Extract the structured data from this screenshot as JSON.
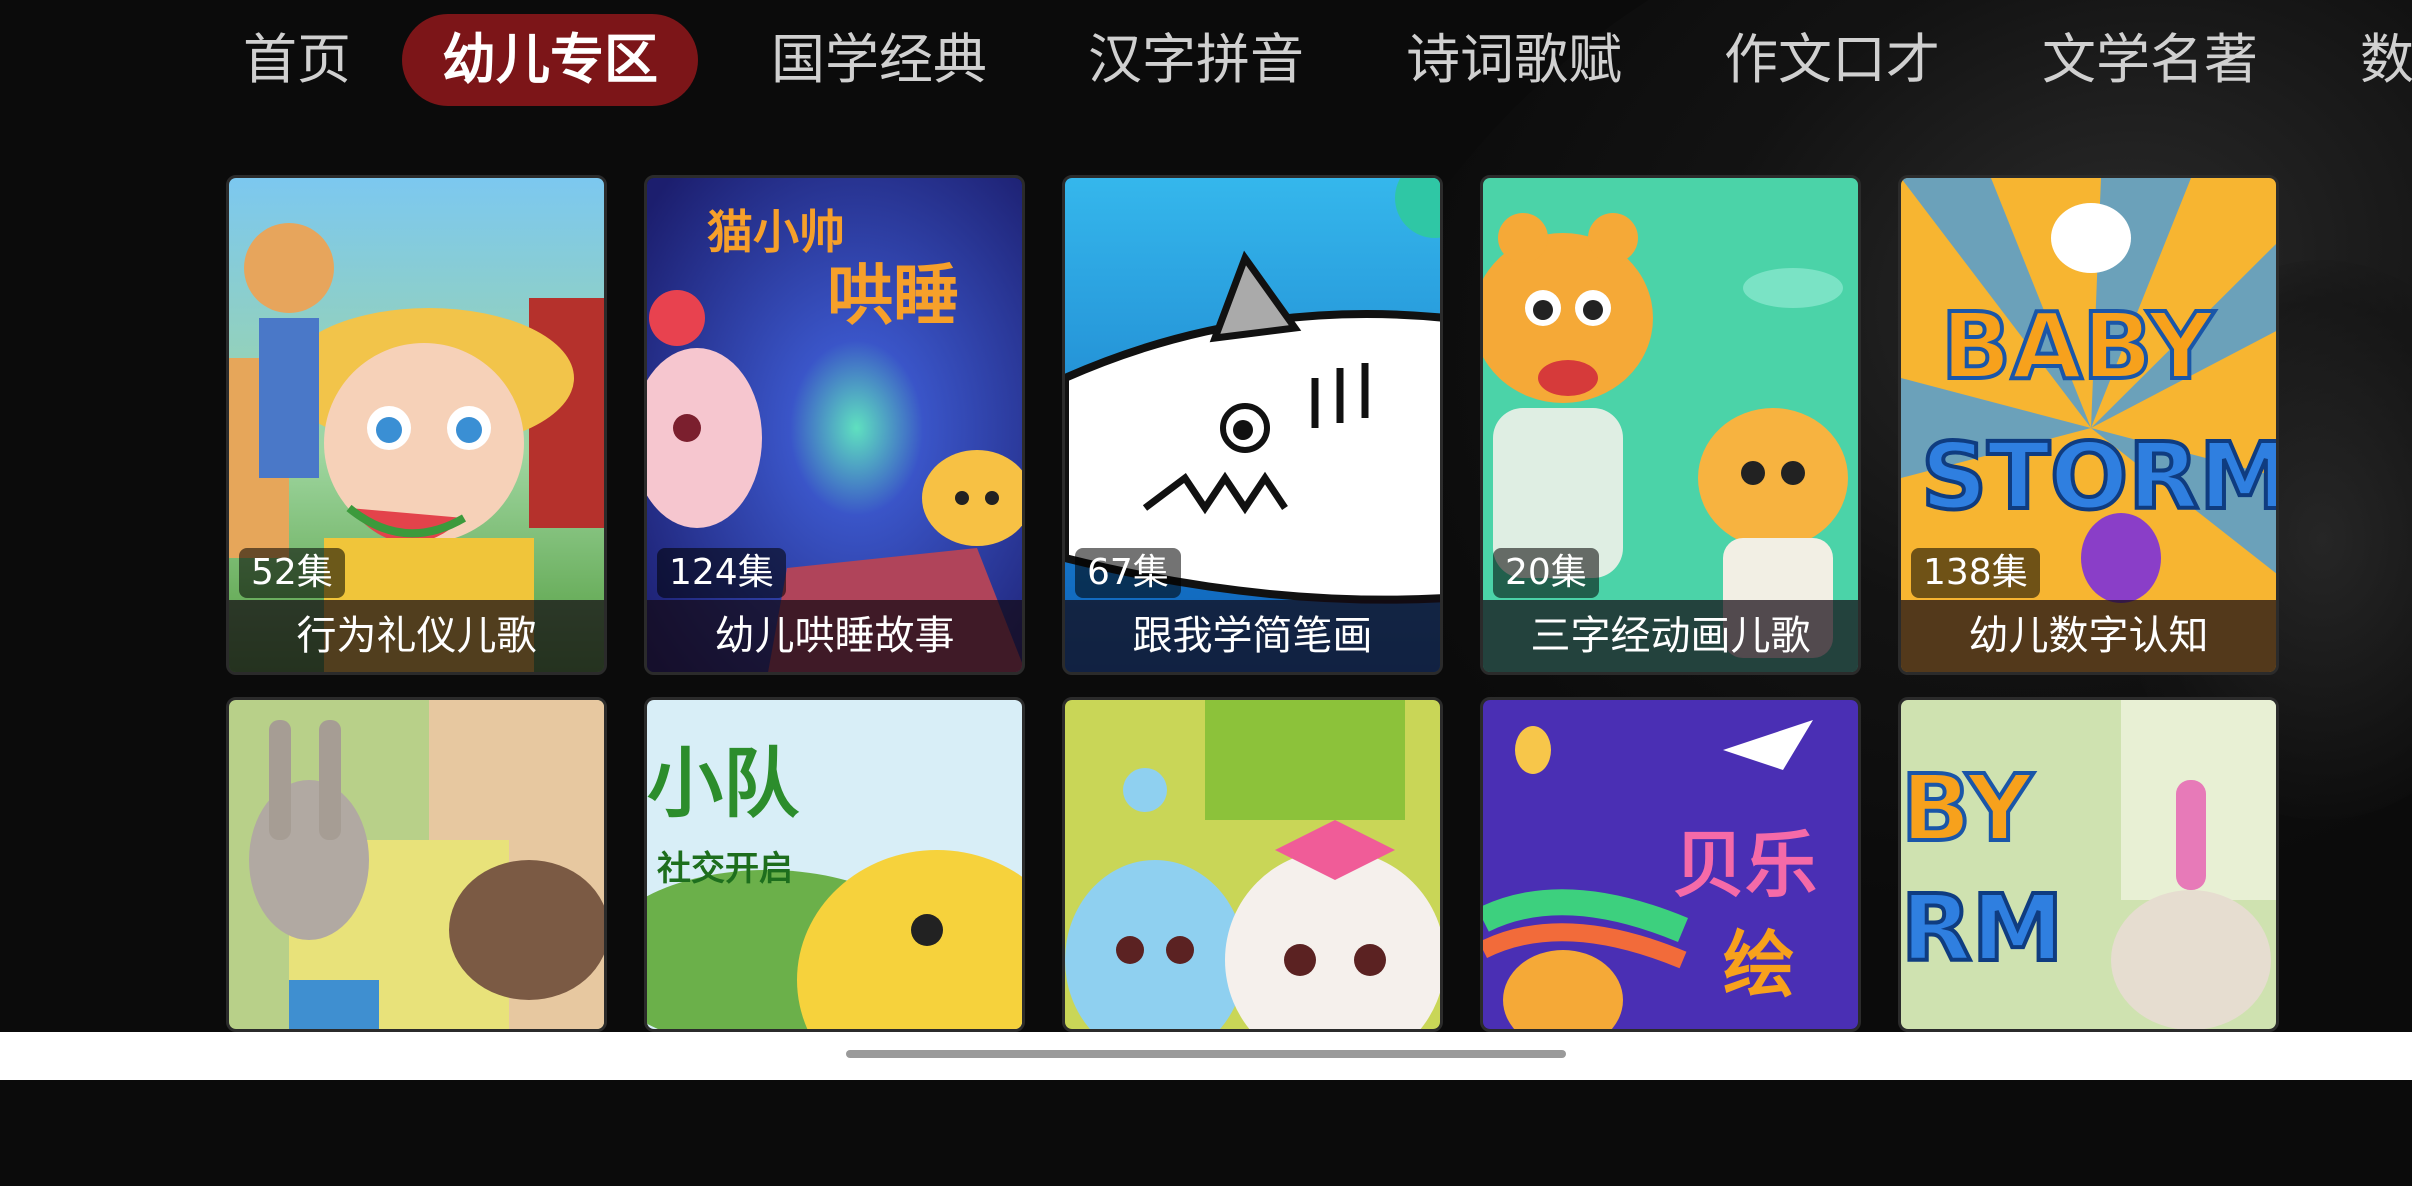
{
  "nav": {
    "tabs": [
      {
        "label": "首页",
        "active": false
      },
      {
        "label": "幼儿专区",
        "active": true
      },
      {
        "label": "国学经典",
        "active": false
      },
      {
        "label": "汉字拼音",
        "active": false
      },
      {
        "label": "诗词歌赋",
        "active": false
      },
      {
        "label": "作文口才",
        "active": false
      },
      {
        "label": "文学名著",
        "active": false
      },
      {
        "label": "数",
        "active": false
      }
    ]
  },
  "row1": [
    {
      "episodes": "52集",
      "title": "行为礼仪儿歌"
    },
    {
      "episodes": "124集",
      "title": "幼儿哄睡故事",
      "art_text": "猫小帅\n哄睡"
    },
    {
      "episodes": "67集",
      "title": "跟我学简笔画"
    },
    {
      "episodes": "20集",
      "title": "三字经动画儿歌"
    },
    {
      "episodes": "138集",
      "title": "幼儿数字认知",
      "art_text": "BABY\nSTORM"
    }
  ],
  "row2": [
    {
      "art_text": ""
    },
    {
      "art_text": "小队\n社交开启"
    },
    {
      "art_text": ""
    },
    {
      "art_text": "贝乐\n绘"
    },
    {
      "art_text": "BY\nRM"
    }
  ],
  "colors": {
    "accent": "#7c1518",
    "background": "#0b0b0b"
  }
}
